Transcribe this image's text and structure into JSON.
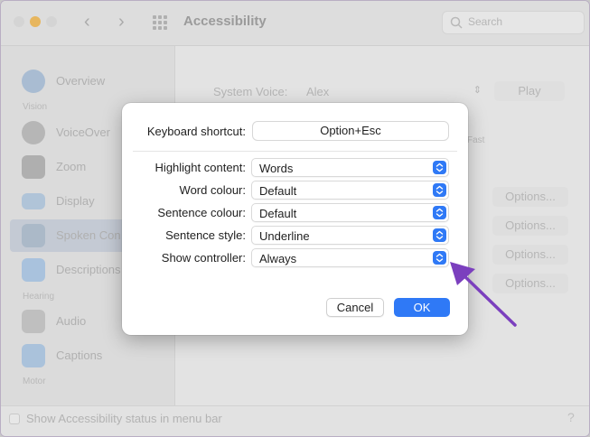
{
  "window": {
    "title": "Accessibility",
    "search_placeholder": "Search"
  },
  "sidebar": {
    "sections": {
      "vision": "Vision",
      "hearing": "Hearing",
      "motor": "Motor"
    },
    "items": [
      {
        "label": "Overview",
        "icon": "overview-icon"
      },
      {
        "label": "VoiceOver",
        "icon": "voiceover-icon"
      },
      {
        "label": "Zoom",
        "icon": "zoom-icon"
      },
      {
        "label": "Display",
        "icon": "display-icon"
      },
      {
        "label": "Spoken Con",
        "icon": "spoken-content-icon",
        "selected": true
      },
      {
        "label": "Descriptions",
        "icon": "descriptions-icon"
      },
      {
        "label": "Audio",
        "icon": "audio-icon"
      },
      {
        "label": "Captions",
        "icon": "captions-icon"
      }
    ]
  },
  "content": {
    "system_voice_label": "System Voice:",
    "system_voice_value": "Alex",
    "play_label": "Play",
    "rate_tag": "Fast",
    "options_label": "Options..."
  },
  "statusbar": {
    "label": "Show Accessibility status in menu bar",
    "help": "?"
  },
  "dialog": {
    "shortcut_label": "Keyboard shortcut:",
    "shortcut_value": "Option+Esc",
    "rows": [
      {
        "label": "Highlight content:",
        "value": "Words"
      },
      {
        "label": "Word colour:",
        "value": "Default"
      },
      {
        "label": "Sentence colour:",
        "value": "Default"
      },
      {
        "label": "Sentence style:",
        "value": "Underline"
      },
      {
        "label": "Show controller:",
        "value": "Always"
      }
    ],
    "cancel_label": "Cancel",
    "ok_label": "OK"
  },
  "colors": {
    "accent": "#2f79f6",
    "annotation_arrow": "#7b3fbe"
  }
}
